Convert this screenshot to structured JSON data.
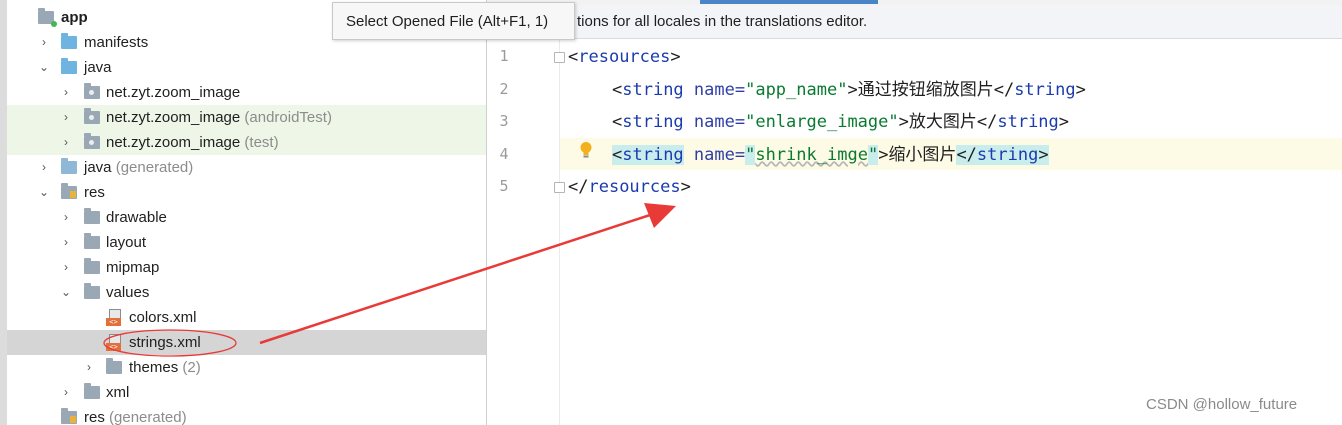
{
  "tooltip": {
    "text": "Select Opened File (Alt+F1, 1)"
  },
  "banner": {
    "text": "tions for all locales in the translations editor."
  },
  "tree": {
    "items": [
      {
        "label": "app",
        "suffix": ""
      },
      {
        "label": "manifests",
        "suffix": ""
      },
      {
        "label": "java",
        "suffix": ""
      },
      {
        "label": "net.zyt.zoom_image",
        "suffix": ""
      },
      {
        "label": "net.zyt.zoom_image",
        "suffix": " (androidTest)"
      },
      {
        "label": "net.zyt.zoom_image",
        "suffix": " (test)"
      },
      {
        "label": "java",
        "suffix": " (generated)"
      },
      {
        "label": "res",
        "suffix": ""
      },
      {
        "label": "drawable",
        "suffix": ""
      },
      {
        "label": "layout",
        "suffix": ""
      },
      {
        "label": "mipmap",
        "suffix": ""
      },
      {
        "label": "values",
        "suffix": ""
      },
      {
        "label": "colors.xml",
        "suffix": ""
      },
      {
        "label": "strings.xml",
        "suffix": ""
      },
      {
        "label": "themes",
        "suffix": " (2)"
      },
      {
        "label": "xml",
        "suffix": ""
      },
      {
        "label": "res",
        "suffix": " (generated)"
      }
    ]
  },
  "editor": {
    "line_numbers": [
      "1",
      "2",
      "3",
      "4",
      "5"
    ],
    "lines": [
      {
        "open": "<",
        "tag": "resources",
        "close": ">"
      },
      {
        "open": "<",
        "tag": "string",
        "attr": " name=",
        "value": "\"app_name\"",
        "gt": ">",
        "text": "通过按钮缩放图片",
        "endopen": "</",
        "endtag": "string",
        "endclose": ">"
      },
      {
        "open": "<",
        "tag": "string",
        "attr": " name=",
        "value": "\"enlarge_image\"",
        "gt": ">",
        "text": "放大图片",
        "endopen": "</",
        "endtag": "string",
        "endclose": ">"
      },
      {
        "open": "<",
        "tag": "string",
        "attr": " name=",
        "q1": "\"",
        "valname": "shrink_imge",
        "q2": "\"",
        "gt": ">",
        "text": "缩小图片",
        "endopen": "</",
        "endtag": "string",
        "endclose": ">"
      },
      {
        "open": "</",
        "tag": "resources",
        "close": ">"
      }
    ]
  },
  "watermark": {
    "text": "CSDN @hollow_future"
  },
  "colors": {
    "annotation": "#e83a36",
    "selection": "#d5d5d5",
    "tab_accent": "#4a86c7"
  }
}
